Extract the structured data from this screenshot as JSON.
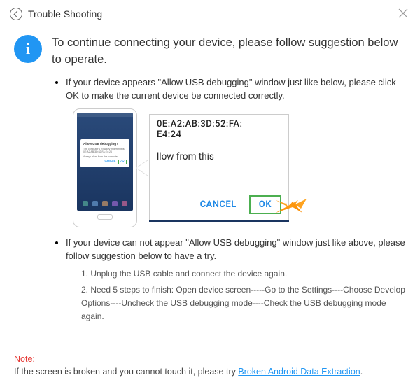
{
  "window": {
    "title": "Trouble Shooting"
  },
  "info_glyph": "i",
  "headline": "To continue connecting your device, please follow suggestion below to operate.",
  "bullet1": "If your device appears \"Allow USB debugging\" window just like below, please click OK to make the current device  be connected correctly.",
  "bullet2": "If your device can not appear \"Allow USB debugging\" window just like above, please follow suggestion below to have a try.",
  "steps": {
    "s1": "1. Unplug the USB cable and connect the device again.",
    "s2": "2. Need 5 steps to finish: Open device screen-----Go to the Settings----Choose Develop Options----Uncheck the USB debugging mode----Check the USB debugging mode again."
  },
  "phone_dialog": {
    "title": "Allow USB debugging?",
    "body": "The computer's RSA key fingerprint is: 0E:A2:AB:3D:52:FA:E4:24",
    "checkbox": "Always allow from this computer",
    "cancel": "CANCEL",
    "ok": "OK"
  },
  "zoom": {
    "mac_line1": "0E:A2:AB:3D:52:FA:",
    "mac_line2": "E4:24",
    "allow_text": "llow from this",
    "cancel": "CANCEL",
    "ok": "OK"
  },
  "footer": {
    "note_label": "Note:",
    "text": "If the screen is broken and you cannot touch it, please try ",
    "link": "Broken Android Data Extraction",
    "period": "."
  }
}
